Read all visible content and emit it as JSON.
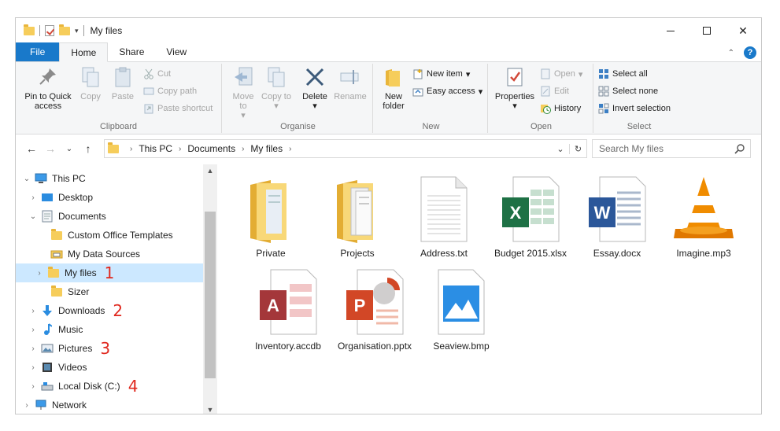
{
  "window": {
    "title": "My files",
    "controls": {
      "minimize": "minimize",
      "maximize": "maximize",
      "close": "✕"
    }
  },
  "ribbon_tabs": [
    "File",
    "Home",
    "Share",
    "View"
  ],
  "ribbon": {
    "clipboard": {
      "label": "Clipboard",
      "pin": "Pin to Quick access",
      "copy": "Copy",
      "paste": "Paste",
      "cut": "Cut",
      "copy_path": "Copy path",
      "paste_shortcut": "Paste shortcut"
    },
    "organise": {
      "label": "Organise",
      "move_to": "Move to",
      "copy_to": "Copy to",
      "delete": "Delete",
      "rename": "Rename"
    },
    "new": {
      "label": "New",
      "new_folder": "New folder",
      "new_item": "New item",
      "easy_access": "Easy access"
    },
    "open": {
      "label": "Open",
      "properties": "Properties",
      "open": "Open",
      "edit": "Edit",
      "history": "History"
    },
    "select": {
      "label": "Select",
      "select_all": "Select all",
      "select_none": "Select none",
      "invert": "Invert selection"
    }
  },
  "address": {
    "crumbs": [
      "This PC",
      "Documents",
      "My files"
    ],
    "search_placeholder": "Search My files"
  },
  "nav_tree": [
    {
      "label": "This PC",
      "icon": "computer-icon",
      "annotation": ""
    },
    {
      "label": "Desktop",
      "icon": "desktop-icon",
      "annotation": ""
    },
    {
      "label": "Documents",
      "icon": "documents-icon",
      "annotation": ""
    },
    {
      "label": "Custom Office Templates",
      "icon": "folder-icon",
      "annotation": ""
    },
    {
      "label": "My Data Sources",
      "icon": "data-sources-icon",
      "annotation": ""
    },
    {
      "label": "My files",
      "icon": "folder-icon",
      "annotation": "1"
    },
    {
      "label": "Sizer",
      "icon": "folder-icon",
      "annotation": ""
    },
    {
      "label": "Downloads",
      "icon": "download-icon",
      "annotation": "2"
    },
    {
      "label": "Music",
      "icon": "music-icon",
      "annotation": ""
    },
    {
      "label": "Pictures",
      "icon": "pictures-icon",
      "annotation": "3"
    },
    {
      "label": "Videos",
      "icon": "videos-icon",
      "annotation": ""
    },
    {
      "label": "Local Disk (C:)",
      "icon": "drive-icon",
      "annotation": "4"
    },
    {
      "label": "Network",
      "icon": "network-icon",
      "annotation": ""
    }
  ],
  "files": [
    {
      "name": "Private",
      "icon": "folder-icon"
    },
    {
      "name": "Projects",
      "icon": "folder-icon"
    },
    {
      "name": "Address.txt",
      "icon": "text-file-icon"
    },
    {
      "name": "Budget 2015.xlsx",
      "icon": "excel-icon"
    },
    {
      "name": "Essay.docx",
      "icon": "word-icon"
    },
    {
      "name": "Imagine.mp3",
      "icon": "vlc-icon"
    },
    {
      "name": "Inventory.accdb",
      "icon": "access-icon"
    },
    {
      "name": "Organisation.pptx",
      "icon": "powerpoint-icon"
    },
    {
      "name": "Seaview.bmp",
      "icon": "image-icon"
    }
  ],
  "colors": {
    "accent": "#1979ca",
    "selection": "#cce8ff",
    "annotation": "#e0281e",
    "folder": "#f6cd5b",
    "excel": "#1e7145",
    "word": "#2b579a",
    "access": "#a4373a",
    "powerpoint": "#d24726",
    "vlc": "#f08c00"
  }
}
